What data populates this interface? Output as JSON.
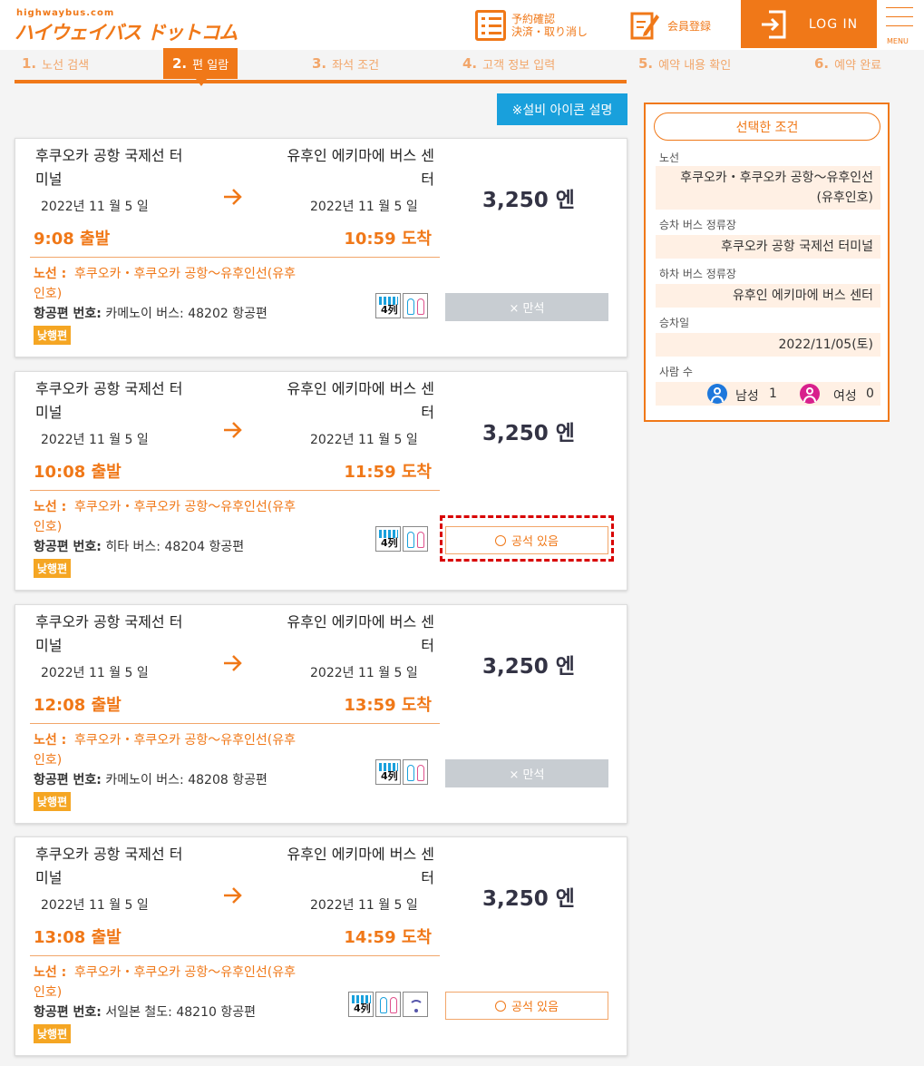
{
  "header": {
    "logo_small": "highwaybus.com",
    "logo_main": "ハイウェイバス ドットコム",
    "reservation_line1": "予約確認",
    "reservation_line2": "決済・取り消し",
    "member": "会員登録",
    "login": "LOG IN",
    "menu": "MENU"
  },
  "steps": [
    {
      "num": "1.",
      "label": "노선 검색"
    },
    {
      "num": "2.",
      "label": "편 일람"
    },
    {
      "num": "3.",
      "label": "좌석 조건"
    },
    {
      "num": "4.",
      "label": "고객 정보 입력"
    },
    {
      "num": "5.",
      "label": "예약 내용 확인"
    },
    {
      "num": "6.",
      "label": "예약 완료"
    }
  ],
  "icon_legend_button": "※설비 아이콘 설명",
  "cards": [
    {
      "from_line1": "후쿠오카 공항 국제선 터",
      "from_line2": "미널",
      "to_line1": "유후인 에키마에 버스 센",
      "to_line2": "터",
      "dep_date": "2022년 11 월 5 일",
      "arr_date": "2022년 11 월 5 일",
      "dep_time": "9:08 출발",
      "arr_time": "10:59 도착",
      "price": "3,250 엔",
      "route_label": "노선 :",
      "route": "후쿠오카・후쿠오카 공항～유후인선(유후인호)",
      "flight_label": "항공편 번호:",
      "flight": "카메노이 버스: 48202 항공편",
      "tag": "낮행편",
      "seat_status": "× 만석",
      "seat_type": "full"
    },
    {
      "from_line1": "후쿠오카 공항 국제선 터",
      "from_line2": "미널",
      "to_line1": "유후인 에키마에 버스 센",
      "to_line2": "터",
      "dep_date": "2022년 11 월 5 일",
      "arr_date": "2022년 11 월 5 일",
      "dep_time": "10:08 출발",
      "arr_time": "11:59 도착",
      "price": "3,250 엔",
      "route_label": "노선 :",
      "route": "후쿠오카・후쿠오카 공항～유후인선(유후인호)",
      "flight_label": "항공편 번호:",
      "flight": "히타 버스: 48204 항공편",
      "tag": "낮행편",
      "seat_status": "공석 있음",
      "seat_type": "available"
    },
    {
      "from_line1": "후쿠오카 공항 국제선 터",
      "from_line2": "미널",
      "to_line1": "유후인 에키마에 버스 센",
      "to_line2": "터",
      "dep_date": "2022년 11 월 5 일",
      "arr_date": "2022년 11 월 5 일",
      "dep_time": "12:08 출발",
      "arr_time": "13:59 도착",
      "price": "3,250 엔",
      "route_label": "노선 :",
      "route": "후쿠오카・후쿠오카 공항～유후인선(유후인호)",
      "flight_label": "항공편 번호:",
      "flight": "카메노이 버스: 48208 항공편",
      "tag": "낮행편",
      "seat_status": "× 만석",
      "seat_type": "full"
    },
    {
      "from_line1": "후쿠오카 공항 국제선 터",
      "from_line2": "미널",
      "to_line1": "유후인 에키마에 버스 센",
      "to_line2": "터",
      "dep_date": "2022년 11 월 5 일",
      "arr_date": "2022년 11 월 5 일",
      "dep_time": "13:08 출발",
      "arr_time": "14:59 도착",
      "price": "3,250 엔",
      "route_label": "노선 :",
      "route": "후쿠오카・후쿠오카 공항～유후인선(유후인호)",
      "flight_label": "항공편 번호:",
      "flight": "서일본 철도: 48210 항공편",
      "tag": "낮행편",
      "seat_status": "공석 있음",
      "seat_type": "available"
    }
  ],
  "facility_4row": "4列",
  "sidebar": {
    "title": "선택한 조건",
    "route_label": "노선",
    "route_line1": "후쿠오카・후쿠오카 공항～유후인선",
    "route_line2": "(유후인호)",
    "board_label": "승차 버스 정류장",
    "board": "후쿠오카 공항 국제선 터미널",
    "alight_label": "하차 버스 정류장",
    "alight": "유후인 에키마에 버스 센터",
    "date_label": "승차일",
    "date": "2022/11/05(토)",
    "people_label": "사람 수",
    "male_label": "남성",
    "male_count": "1",
    "female_label": "여성",
    "female_count": "0"
  },
  "colors": {
    "accent": "#f07818",
    "info": "#19a0dc",
    "full": "#c8cdd2",
    "male": "#1e78dc",
    "female": "#d8208c"
  }
}
